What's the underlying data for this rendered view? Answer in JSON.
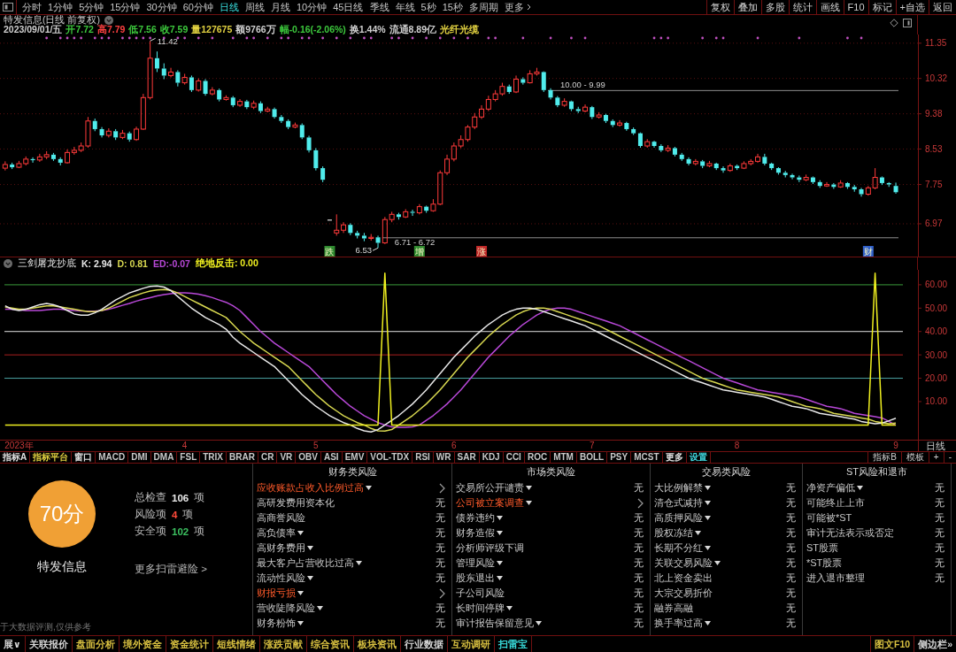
{
  "toolbar": {
    "periods": [
      {
        "label": "分时",
        "selected": false
      },
      {
        "label": "1分钟",
        "selected": false
      },
      {
        "label": "5分钟",
        "selected": false
      },
      {
        "label": "15分钟",
        "selected": false
      },
      {
        "label": "30分钟",
        "selected": false
      },
      {
        "label": "60分钟",
        "selected": false
      },
      {
        "label": "日线",
        "selected": true
      },
      {
        "label": "周线",
        "selected": false
      },
      {
        "label": "月线",
        "selected": false
      },
      {
        "label": "10分钟",
        "selected": false
      },
      {
        "label": "45日线",
        "selected": false
      },
      {
        "label": "季线",
        "selected": false
      },
      {
        "label": "年线",
        "selected": false
      },
      {
        "label": "5秒",
        "selected": false
      },
      {
        "label": "15秒",
        "selected": false
      },
      {
        "label": "多周期",
        "selected": false
      }
    ],
    "more": "更多",
    "actions": [
      "复权",
      "叠加",
      "多股",
      "统计",
      "画线",
      "F10",
      "标记",
      "+自选",
      "返回"
    ]
  },
  "price_pane": {
    "title": "特发信息(日线 前复权)",
    "quote": [
      {
        "text": "2023/09/01/五",
        "color": "#d0d0d0"
      },
      {
        "text": "开7.72",
        "color": "#3cc83c"
      },
      {
        "text": "高7.79",
        "color": "#ff4040"
      },
      {
        "text": "低7.56",
        "color": "#3cc83c"
      },
      {
        "text": "收7.59",
        "color": "#3cc83c"
      },
      {
        "text": "量127675",
        "color": "#e0d040"
      },
      {
        "text": "额9766万",
        "color": "#d0d0d0"
      },
      {
        "text": "幅-0.16(-2.06%)",
        "color": "#3cc83c"
      },
      {
        "text": "换1.44%",
        "color": "#d0d0d0"
      },
      {
        "text": "流通8.89亿",
        "color": "#d0d0d0"
      },
      {
        "text": "光纤光缆",
        "color": "#e0d040"
      }
    ],
    "chart_data": [
      {
        "type": "candlestick",
        "log": true,
        "grid": true,
        "ylim": [
          6.38,
          11.62
        ],
        "yticks": [
          6.97,
          7.75,
          8.53,
          9.38,
          10.32,
          11.35
        ],
        "ohlc": [
          [
            8.1,
            8.25,
            8.05,
            8.18
          ],
          [
            8.18,
            8.22,
            8.08,
            8.12
          ],
          [
            8.12,
            8.26,
            8.1,
            8.2
          ],
          [
            8.2,
            8.36,
            8.16,
            8.3
          ],
          [
            8.3,
            8.34,
            8.22,
            8.28
          ],
          [
            8.28,
            8.42,
            8.24,
            8.35
          ],
          [
            8.35,
            8.48,
            8.3,
            8.4
          ],
          [
            8.4,
            8.44,
            8.26,
            8.3
          ],
          [
            8.3,
            8.34,
            8.16,
            8.22
          ],
          [
            8.22,
            8.52,
            8.2,
            8.45
          ],
          [
            8.45,
            8.58,
            8.4,
            8.5
          ],
          [
            8.5,
            8.68,
            8.46,
            8.6
          ],
          [
            8.6,
            9.3,
            8.56,
            9.2
          ],
          [
            9.2,
            9.26,
            8.95,
            9.0
          ],
          [
            9.0,
            9.05,
            8.8,
            8.85
          ],
          [
            8.85,
            9.02,
            8.8,
            8.95
          ],
          [
            8.95,
            9.0,
            8.74,
            8.8
          ],
          [
            8.8,
            8.98,
            8.76,
            8.9
          ],
          [
            8.9,
            8.94,
            8.7,
            8.75
          ],
          [
            8.75,
            9.06,
            8.72,
            9.0
          ],
          [
            9.0,
            9.9,
            8.98,
            9.8
          ],
          [
            9.8,
            11.42,
            9.75,
            10.9
          ],
          [
            10.9,
            11.1,
            10.5,
            10.6
          ],
          [
            10.6,
            10.75,
            10.3,
            10.4
          ],
          [
            10.4,
            10.62,
            10.35,
            10.5
          ],
          [
            10.5,
            10.55,
            10.1,
            10.2
          ],
          [
            10.2,
            10.45,
            10.15,
            10.35
          ],
          [
            10.35,
            10.4,
            9.95,
            10.0
          ],
          [
            10.0,
            10.32,
            9.96,
            10.25
          ],
          [
            10.25,
            10.3,
            9.85,
            9.9
          ],
          [
            9.9,
            10.08,
            9.86,
            10.0
          ],
          [
            10.0,
            10.04,
            9.7,
            9.75
          ],
          [
            9.75,
            9.86,
            9.72,
            9.8
          ],
          [
            9.8,
            9.84,
            9.55,
            9.6
          ],
          [
            9.6,
            9.76,
            9.56,
            9.7
          ],
          [
            9.7,
            9.74,
            9.5,
            9.55
          ],
          [
            9.55,
            9.72,
            9.5,
            9.65
          ],
          [
            9.65,
            9.7,
            9.4,
            9.45
          ],
          [
            9.45,
            9.56,
            9.42,
            9.5
          ],
          [
            9.5,
            9.54,
            9.26,
            9.3
          ],
          [
            9.3,
            9.35,
            9.15,
            9.2
          ],
          [
            9.2,
            9.24,
            9.0,
            9.05
          ],
          [
            9.05,
            9.16,
            9.02,
            9.1
          ],
          [
            9.1,
            9.14,
            8.76,
            8.8
          ],
          [
            8.8,
            8.84,
            8.45,
            8.5
          ],
          [
            8.5,
            8.55,
            8.05,
            8.1
          ],
          [
            8.1,
            8.14,
            7.8,
            7.85
          ],
          [
            7.05,
            7.05,
            7.05,
            7.05
          ],
          [
            6.8,
            7.15,
            6.75,
            6.85
          ],
          [
            6.85,
            7.0,
            6.8,
            6.95
          ],
          [
            6.95,
            6.98,
            6.76,
            6.8
          ],
          [
            6.8,
            6.84,
            6.7,
            6.75
          ],
          [
            6.75,
            6.8,
            6.65,
            6.7
          ],
          [
            6.7,
            6.78,
            6.66,
            6.72
          ],
          [
            6.72,
            6.75,
            6.53,
            6.62
          ],
          [
            6.62,
            7.1,
            6.6,
            7.05
          ],
          [
            7.05,
            7.2,
            7.0,
            7.15
          ],
          [
            7.15,
            7.18,
            7.05,
            7.1
          ],
          [
            7.1,
            7.25,
            7.08,
            7.2
          ],
          [
            7.2,
            7.24,
            7.12,
            7.18
          ],
          [
            7.18,
            7.35,
            7.15,
            7.3
          ],
          [
            7.3,
            7.32,
            7.18,
            7.22
          ],
          [
            7.22,
            7.45,
            7.2,
            7.35
          ],
          [
            7.35,
            8.05,
            7.33,
            8.0
          ],
          [
            8.0,
            8.4,
            7.95,
            8.3
          ],
          [
            8.3,
            8.68,
            8.25,
            8.6
          ],
          [
            8.6,
            8.85,
            8.55,
            8.75
          ],
          [
            8.75,
            9.1,
            8.7,
            9.05
          ],
          [
            9.05,
            9.4,
            9.0,
            9.3
          ],
          [
            9.3,
            9.6,
            9.25,
            9.5
          ],
          [
            9.5,
            9.85,
            9.45,
            9.75
          ],
          [
            9.75,
            10.0,
            9.7,
            9.9
          ],
          [
            9.9,
            10.2,
            9.85,
            10.1
          ],
          [
            10.1,
            10.15,
            9.9,
            9.95
          ],
          [
            9.95,
            10.4,
            9.92,
            10.3
          ],
          [
            10.3,
            10.35,
            10.15,
            10.2
          ],
          [
            10.2,
            10.55,
            10.18,
            10.45
          ],
          [
            10.45,
            10.62,
            10.4,
            10.5
          ],
          [
            10.5,
            10.52,
            9.95,
            10.0
          ],
          [
            10.0,
            10.05,
            9.75,
            9.8
          ],
          [
            9.8,
            9.84,
            9.55,
            9.6
          ],
          [
            9.6,
            9.78,
            9.56,
            9.7
          ],
          [
            9.7,
            9.72,
            9.45,
            9.5
          ],
          [
            9.5,
            9.56,
            9.4,
            9.45
          ],
          [
            9.45,
            9.62,
            9.42,
            9.55
          ],
          [
            9.55,
            9.58,
            9.25,
            9.3
          ],
          [
            9.3,
            9.42,
            9.26,
            9.35
          ],
          [
            9.35,
            9.38,
            9.15,
            9.2
          ],
          [
            9.2,
            9.24,
            9.05,
            9.1
          ],
          [
            9.1,
            9.22,
            9.06,
            9.15
          ],
          [
            9.15,
            9.18,
            8.96,
            9.0
          ],
          [
            9.0,
            9.04,
            8.86,
            8.9
          ],
          [
            8.9,
            8.92,
            8.56,
            8.6
          ],
          [
            8.6,
            8.76,
            8.56,
            8.7
          ],
          [
            8.7,
            8.72,
            8.56,
            8.6
          ],
          [
            8.6,
            8.64,
            8.46,
            8.5
          ],
          [
            8.5,
            8.62,
            8.46,
            8.55
          ],
          [
            8.55,
            8.58,
            8.36,
            8.4
          ],
          [
            8.4,
            8.44,
            8.26,
            8.3
          ],
          [
            8.3,
            8.34,
            8.16,
            8.2
          ],
          [
            8.2,
            8.3,
            8.16,
            8.25
          ],
          [
            8.25,
            8.28,
            8.1,
            8.15
          ],
          [
            8.15,
            8.26,
            8.12,
            8.2
          ],
          [
            8.2,
            8.22,
            8.06,
            8.1
          ],
          [
            8.1,
            8.14,
            8.0,
            8.05
          ],
          [
            8.05,
            8.2,
            8.02,
            8.15
          ],
          [
            8.15,
            8.18,
            8.06,
            8.1
          ],
          [
            8.1,
            8.25,
            8.08,
            8.2
          ],
          [
            8.2,
            8.3,
            8.16,
            8.25
          ],
          [
            8.25,
            8.42,
            8.22,
            8.35
          ],
          [
            8.35,
            8.42,
            8.16,
            8.2
          ],
          [
            8.2,
            8.22,
            8.06,
            8.1
          ],
          [
            8.1,
            8.12,
            7.96,
            8.0
          ],
          [
            8.0,
            8.04,
            7.9,
            7.95
          ],
          [
            7.95,
            7.98,
            7.86,
            7.9
          ],
          [
            7.9,
            7.94,
            7.8,
            7.85
          ],
          [
            7.85,
            7.96,
            7.82,
            7.9
          ],
          [
            7.9,
            7.92,
            7.76,
            7.8
          ],
          [
            7.8,
            7.84,
            7.68,
            7.72
          ],
          [
            7.72,
            7.8,
            7.7,
            7.75
          ],
          [
            7.75,
            7.78,
            7.66,
            7.7
          ],
          [
            7.7,
            7.84,
            7.68,
            7.78
          ],
          [
            7.78,
            7.8,
            7.66,
            7.7
          ],
          [
            7.7,
            7.74,
            7.6,
            7.65
          ],
          [
            7.65,
            7.68,
            7.5,
            7.55
          ],
          [
            7.55,
            7.72,
            7.52,
            7.68
          ],
          [
            7.68,
            8.1,
            7.65,
            7.9
          ],
          [
            7.9,
            7.92,
            7.74,
            7.78
          ],
          [
            7.78,
            7.8,
            7.7,
            7.75
          ],
          [
            7.72,
            7.79,
            7.56,
            7.59
          ]
        ],
        "bands": [
          {
            "axis": "y",
            "from": 9.99,
            "to": 10.0,
            "label": "10.00 - 9.99",
            "color": "#8c8c8c"
          },
          {
            "axis": "y",
            "from": 6.71,
            "to": 6.72,
            "label": "6.71 - 6.72",
            "color": "#8c8c8c"
          }
        ]
      }
    ],
    "extreme_labels": [
      {
        "label": "11.42",
        "kind": "high"
      },
      {
        "label": "6.53",
        "kind": "low"
      }
    ],
    "event_tags": [
      {
        "label": "跌",
        "color": "#2f8a2f"
      },
      {
        "label": "增",
        "color": "#2f8a2f"
      },
      {
        "label": "涨",
        "color": "#c02828"
      },
      {
        "label": "财",
        "color": "#2f5fc8"
      }
    ]
  },
  "indicator_pane": {
    "title": "三剑屠龙抄底",
    "readouts": [
      {
        "text": "K: 2.94",
        "color": "#e8e8e8"
      },
      {
        "text": "D: 0.81",
        "color": "#d8d850"
      },
      {
        "text": "ED:-0.07",
        "color": "#b848d8"
      },
      {
        "text": "绝地反击: 0.00",
        "color": "#f0f020"
      }
    ],
    "period_label": "日线",
    "chart_data": [
      {
        "type": "line",
        "ylim": [
          -6.3,
          66.4
        ],
        "categories": [
          null,
          null,
          "2023年",
          null,
          null,
          null,
          null,
          null,
          null,
          null,
          null,
          null,
          null,
          null,
          null,
          null,
          null,
          null,
          null,
          null,
          null,
          null,
          null,
          null,
          null,
          null,
          "4",
          null,
          null,
          null,
          null,
          null,
          null,
          null,
          null,
          null,
          null,
          null,
          null,
          null,
          null,
          null,
          null,
          null,
          null,
          "5",
          null,
          null,
          null,
          null,
          null,
          null,
          null,
          null,
          null,
          null,
          null,
          null,
          null,
          null,
          null,
          null,
          null,
          null,
          null,
          "6",
          null,
          null,
          null,
          null,
          null,
          null,
          null,
          null,
          null,
          null,
          null,
          null,
          null,
          null,
          null,
          null,
          null,
          null,
          null,
          "7",
          null,
          null,
          null,
          null,
          null,
          null,
          null,
          null,
          null,
          null,
          null,
          null,
          null,
          null,
          null,
          null,
          null,
          null,
          null,
          null,
          "8",
          null,
          null,
          null,
          null,
          null,
          null,
          null,
          null,
          null,
          null,
          null,
          null,
          null,
          null,
          null,
          null,
          null,
          null,
          null,
          null,
          null,
          null,
          "9"
        ],
        "yticks": [
          {
            "value": 10,
            "label": "10.00"
          },
          {
            "value": 20,
            "label": "20.00"
          },
          {
            "value": 30,
            "label": "30.00"
          },
          {
            "value": 40,
            "label": "40.00"
          },
          {
            "value": 50,
            "label": "50.00"
          },
          {
            "value": 60,
            "label": "60.00"
          }
        ],
        "ref_lines": [
          {
            "axis": "y",
            "value": 60,
            "color": "#3a9a3a"
          },
          {
            "axis": "y",
            "value": 40,
            "color": "#e0e0e0"
          },
          {
            "axis": "y",
            "value": 30,
            "color": "#a82020"
          },
          {
            "axis": "y",
            "value": 20,
            "color": "#4aa0a0"
          }
        ],
        "series": [
          {
            "color": "#b848d8",
            "values": [
              49.5,
              49.5,
              49.3,
              49,
              49,
              49,
              49.3,
              49.5,
              49.5,
              49.3,
              49,
              48.8,
              48.7,
              48.7,
              49,
              49.5,
              50.3,
              51.2,
              52,
              53,
              53.8,
              54.5,
              55.2,
              55.8,
              56.2,
              56.5,
              56.6,
              56.4,
              56,
              55.3,
              54.5,
              53.5,
              52.5,
              51,
              49,
              46,
              43,
              40,
              37.5,
              35,
              33,
              31,
              29,
              27,
              25,
              22,
              19,
              16,
              13,
              10.5,
              8,
              6,
              4,
              2.5,
              1,
              0,
              -0.8,
              -1,
              -1,
              -0.8,
              0,
              2,
              4,
              6.5,
              9,
              12,
              15,
              18.5,
              22,
              25.5,
              29,
              32,
              35,
              38,
              40.5,
              43,
              45,
              47,
              48.5,
              49.5,
              50,
              50,
              49.5,
              48.5,
              47.5,
              46.5,
              45.5,
              44.5,
              43.5,
              42.5,
              41,
              39.5,
              38,
              36.5,
              35,
              33.5,
              32,
              30.5,
              29,
              27.5,
              26,
              24.5,
              23,
              21.5,
              20,
              19,
              18,
              17,
              16,
              15,
              14.5,
              14,
              13.5,
              13,
              12.5,
              12,
              11,
              10,
              9,
              8,
              7.5,
              7,
              6,
              5,
              4.5,
              4,
              3.5,
              3,
              1.5,
              -0.1
            ]
          },
          {
            "color": "#d8d850",
            "values": [
              50.5,
              50,
              49.5,
              49.5,
              50,
              50.5,
              51,
              51,
              50.5,
              50,
              49.5,
              49,
              48.5,
              48.5,
              49,
              50,
              51.5,
              53,
              54.5,
              55.5,
              56.5,
              57.3,
              57.8,
              58,
              57.6,
              56.5,
              55,
              53.5,
              52,
              50.5,
              49,
              47.5,
              46,
              43,
              40,
              37.5,
              35,
              33,
              31,
              29,
              27,
              25,
              22,
              19,
              16,
              13,
              10.5,
              8,
              6,
              4,
              2.5,
              1,
              0,
              -1.5,
              -2.5,
              -2.6,
              -2,
              0,
              2,
              4,
              6.5,
              9,
              12,
              15,
              18.5,
              22,
              25.5,
              29,
              32,
              35,
              38,
              40.5,
              43,
              45,
              47,
              48.5,
              49.5,
              50,
              50,
              49.5,
              48.5,
              47.5,
              46.5,
              45.5,
              44.5,
              43.5,
              42.5,
              41,
              39.5,
              38,
              36.5,
              35,
              33.5,
              32,
              30.5,
              29,
              27.5,
              26,
              24.5,
              23,
              21.5,
              20,
              19,
              18,
              17,
              16,
              15,
              14.5,
              14,
              13.5,
              13,
              12.5,
              12,
              11,
              10,
              9,
              8,
              7.5,
              7,
              6,
              5,
              4.5,
              4,
              3.5,
              3,
              2.5,
              1.5,
              1,
              0.5,
              0.8
            ]
          },
          {
            "color": "#e8e8e8",
            "values": [
              51,
              49.5,
              49,
              49.5,
              50.5,
              51.5,
              52,
              51.5,
              50.5,
              49,
              47.5,
              47,
              47,
              48,
              49.5,
              51.5,
              53.5,
              55,
              56.5,
              57.5,
              58.5,
              59.3,
              59.5,
              59,
              57.5,
              55,
              52.5,
              50,
              48,
              46,
              44.5,
              43,
              41,
              37.5,
              35,
              33,
              31,
              29,
              27,
              25,
              22,
              19,
              16,
              13,
              10.5,
              8,
              6,
              4,
              2.5,
              1,
              0,
              -1.5,
              -2.5,
              -3,
              -2,
              0,
              2,
              4,
              6.5,
              9,
              12,
              15,
              18.5,
              22,
              25.5,
              29,
              32,
              35,
              38,
              40.5,
              43,
              45,
              47,
              48.5,
              49.5,
              50,
              50,
              49.5,
              48.5,
              47.5,
              46.5,
              45.5,
              44.5,
              43.5,
              42.5,
              41,
              39.5,
              38,
              36.5,
              35,
              33.5,
              32,
              30.5,
              29,
              27.5,
              26,
              24.5,
              23,
              21.5,
              20,
              19,
              18,
              17,
              16,
              15,
              14.5,
              14,
              13.5,
              13,
              12.5,
              12,
              11,
              10,
              9,
              8,
              7.5,
              7,
              6,
              5,
              4.5,
              4,
              3.5,
              3,
              2.5,
              1.5,
              1,
              0.5,
              0.8,
              1.8,
              2.9
            ]
          },
          {
            "color": "#f0f020",
            "values": [
              0,
              0,
              0,
              0,
              0,
              0,
              0,
              0,
              0,
              0,
              0,
              0,
              0,
              0,
              0,
              0,
              0,
              0,
              0,
              0,
              0,
              0,
              0,
              0,
              0,
              0,
              0,
              0,
              0,
              0,
              0,
              0,
              0,
              0,
              0,
              0,
              0,
              0,
              0,
              0,
              0,
              0,
              0,
              0,
              0,
              0,
              0,
              0,
              0,
              0,
              0,
              0,
              0,
              0,
              0,
              65,
              0,
              0,
              0,
              0,
              0,
              0,
              0,
              0,
              0,
              0,
              0,
              0,
              0,
              0,
              0,
              0,
              0,
              0,
              0,
              0,
              0,
              0,
              0,
              0,
              0,
              0,
              0,
              0,
              0,
              0,
              0,
              0,
              0,
              0,
              0,
              0,
              0,
              0,
              0,
              0,
              0,
              0,
              0,
              0,
              0,
              0,
              0,
              0,
              0,
              0,
              0,
              0,
              0,
              0,
              0,
              0,
              0,
              0,
              0,
              0,
              0,
              0,
              0,
              0,
              0,
              0,
              0,
              0,
              0,
              0,
              65,
              0,
              0,
              0
            ]
          }
        ]
      }
    ]
  },
  "indicator_tabs": {
    "left": [
      {
        "label": "指标A",
        "color": "#e0e0e0"
      },
      {
        "label": "指标平台",
        "color": "#e0d040"
      },
      {
        "label": "窗口",
        "color": "#e0e0e0"
      },
      {
        "label": "MACD",
        "color": "#c8c8c8"
      },
      {
        "label": "DMI",
        "color": "#c8c8c8"
      },
      {
        "label": "DMA",
        "color": "#c8c8c8"
      },
      {
        "label": "FSL",
        "color": "#c8c8c8"
      },
      {
        "label": "TRIX",
        "color": "#c8c8c8"
      },
      {
        "label": "BRAR",
        "color": "#c8c8c8"
      },
      {
        "label": "CR",
        "color": "#c8c8c8"
      },
      {
        "label": "VR",
        "color": "#c8c8c8"
      },
      {
        "label": "OBV",
        "color": "#c8c8c8"
      },
      {
        "label": "ASI",
        "color": "#c8c8c8"
      },
      {
        "label": "EMV",
        "color": "#c8c8c8"
      },
      {
        "label": "VOL-TDX",
        "color": "#c8c8c8"
      },
      {
        "label": "RSI",
        "color": "#c8c8c8"
      },
      {
        "label": "WR",
        "color": "#c8c8c8"
      },
      {
        "label": "SAR",
        "color": "#c8c8c8"
      },
      {
        "label": "KDJ",
        "color": "#c8c8c8"
      },
      {
        "label": "CCI",
        "color": "#c8c8c8"
      },
      {
        "label": "ROC",
        "color": "#c8c8c8"
      },
      {
        "label": "MTM",
        "color": "#c8c8c8"
      },
      {
        "label": "BOLL",
        "color": "#c8c8c8"
      },
      {
        "label": "PSY",
        "color": "#c8c8c8"
      },
      {
        "label": "MCST",
        "color": "#c8c8c8"
      },
      {
        "label": "更多",
        "color": "#e0e0e0"
      },
      {
        "label": "设置",
        "color": "#40d8e0"
      }
    ],
    "right": [
      "指标B",
      "模板",
      "+",
      "-"
    ]
  },
  "risk_scan": {
    "score": "70分",
    "company": "特发信息",
    "stats": [
      {
        "label": "总检查",
        "value": "106",
        "unit": "项",
        "color": "#e8e8e8"
      },
      {
        "label": "风险项",
        "value": "4",
        "unit": "项",
        "color": "#ff4a3a"
      },
      {
        "label": "安全项",
        "value": "102",
        "unit": "项",
        "color": "#3cc060"
      }
    ],
    "more_link": "更多扫雷避险 >",
    "note": "于大数据评测,仅供参考",
    "groups": [
      {
        "title": "财务类风险",
        "items": [
          {
            "label": "应收账款占收入比例过高",
            "details": true,
            "risk": true
          },
          {
            "label": "高研发费用资本化",
            "details": false,
            "risk": false,
            "result": "无"
          },
          {
            "label": "高商誉风险",
            "details": false,
            "risk": false,
            "result": "无"
          },
          {
            "label": "高负债率",
            "details": true,
            "risk": false,
            "result": "无"
          },
          {
            "label": "高财务费用",
            "details": true,
            "risk": false,
            "result": "无"
          },
          {
            "label": "最大客户占营收比过高",
            "details": true,
            "risk": false,
            "result": "无"
          },
          {
            "label": "流动性风险",
            "details": true,
            "risk": false,
            "result": "无"
          },
          {
            "label": "财报亏损",
            "details": true,
            "risk": true
          },
          {
            "label": "营收陡降风险",
            "details": true,
            "risk": false,
            "result": "无"
          },
          {
            "label": "财务粉饰",
            "details": true,
            "risk": false,
            "result": "无"
          }
        ]
      },
      {
        "title": "市场类风险",
        "items": [
          {
            "label": "交易所公开谴责",
            "details": true,
            "risk": false,
            "result": "无"
          },
          {
            "label": "公司被立案调查",
            "details": true,
            "risk": true
          },
          {
            "label": "债券违约",
            "details": true,
            "risk": false,
            "result": "无"
          },
          {
            "label": "财务造假",
            "details": true,
            "risk": false,
            "result": "无"
          },
          {
            "label": "分析师评级下调",
            "details": false,
            "risk": false,
            "result": "无"
          },
          {
            "label": "管理风险",
            "details": true,
            "risk": false,
            "result": "无"
          },
          {
            "label": "股东退出",
            "details": true,
            "risk": false,
            "result": "无"
          },
          {
            "label": "子公司风险",
            "details": false,
            "risk": false,
            "result": "无"
          },
          {
            "label": "长时间停牌",
            "details": true,
            "risk": false,
            "result": "无"
          },
          {
            "label": "审计报告保留意见",
            "details": true,
            "risk": false,
            "result": "无"
          }
        ]
      },
      {
        "title": "交易类风险",
        "items": [
          {
            "label": "大比例解禁",
            "details": true,
            "risk": false,
            "result": "无"
          },
          {
            "label": "清仓式减持",
            "details": true,
            "risk": false,
            "result": "无"
          },
          {
            "label": "高质押风险",
            "details": true,
            "risk": false,
            "result": "无"
          },
          {
            "label": "股权冻结",
            "details": true,
            "risk": false,
            "result": "无"
          },
          {
            "label": "长期不分红",
            "details": true,
            "risk": false,
            "result": "无"
          },
          {
            "label": "关联交易风险",
            "details": true,
            "risk": false,
            "result": "无"
          },
          {
            "label": "北上资金卖出",
            "details": false,
            "risk": false,
            "result": "无"
          },
          {
            "label": "大宗交易折价",
            "details": false,
            "risk": false,
            "result": "无"
          },
          {
            "label": "融券高融",
            "details": false,
            "risk": false,
            "result": "无"
          },
          {
            "label": "换手率过高",
            "details": true,
            "risk": false,
            "result": "无"
          }
        ]
      },
      {
        "title": "ST风险和退市",
        "items": [
          {
            "label": "净资产偏低",
            "details": true,
            "risk": false,
            "result": "无"
          },
          {
            "label": "可能终止上市",
            "details": false,
            "risk": false,
            "result": "无"
          },
          {
            "label": "可能被*ST",
            "details": false,
            "risk": false,
            "result": "无"
          },
          {
            "label": "审计无法表示或否定",
            "details": false,
            "risk": false,
            "result": "无"
          },
          {
            "label": "ST股票",
            "details": false,
            "risk": false,
            "result": "无"
          },
          {
            "label": "*ST股票",
            "details": false,
            "risk": false,
            "result": "无"
          },
          {
            "label": "进入退市整理",
            "details": false,
            "risk": false,
            "result": "无"
          }
        ]
      }
    ]
  },
  "bottom_tabs": {
    "items": [
      {
        "label": "展∨",
        "selected": false,
        "color": "#d8d8d8"
      },
      {
        "label": "关联报价",
        "selected": false,
        "color": "#d8d8d8"
      },
      {
        "label": "盘面分析",
        "selected": false,
        "color": "#d8c040"
      },
      {
        "label": "境外资金",
        "selected": false,
        "color": "#d8c040"
      },
      {
        "label": "资金统计",
        "selected": false,
        "color": "#d8c040"
      },
      {
        "label": "短线情绪",
        "selected": false,
        "color": "#d8c040"
      },
      {
        "label": "涨跌贡献",
        "selected": false,
        "color": "#d8c040"
      },
      {
        "label": "综合资讯",
        "selected": false,
        "color": "#d8c040"
      },
      {
        "label": "板块资讯",
        "selected": false,
        "color": "#d8c040"
      },
      {
        "label": "行业数据",
        "selected": false,
        "color": "#d8d8d8"
      },
      {
        "label": "互动调研",
        "selected": false,
        "color": "#d8c040"
      },
      {
        "label": "扫雷宝",
        "selected": true
      }
    ],
    "right": [
      {
        "label": "图文F10",
        "color": "#d8c040"
      },
      {
        "label": "侧边栏»",
        "color": "#d8d8d8"
      }
    ]
  }
}
